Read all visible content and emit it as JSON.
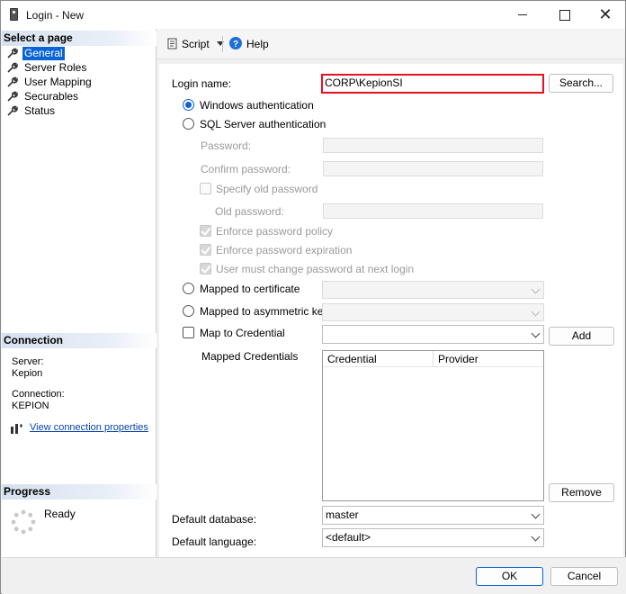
{
  "window": {
    "title": "Login - New"
  },
  "left_panel": {
    "select_page_header": "Select a page",
    "pages": [
      {
        "label": "General",
        "icon": "wrench-icon",
        "selected": true
      },
      {
        "label": "Server Roles",
        "icon": "wrench-icon",
        "selected": false
      },
      {
        "label": "User Mapping",
        "icon": "wrench-icon",
        "selected": false
      },
      {
        "label": "Securables",
        "icon": "wrench-icon",
        "selected": false
      },
      {
        "label": "Status",
        "icon": "wrench-icon",
        "selected": false
      }
    ],
    "connection": {
      "header": "Connection",
      "server_label": "Server:",
      "server_value": "Kepion",
      "connection_label": "Connection:",
      "connection_value": "KEPION",
      "view_properties_link": "View connection properties"
    },
    "progress": {
      "header": "Progress",
      "status": "Ready"
    }
  },
  "toolbar": {
    "script_label": "Script",
    "help_label": "Help"
  },
  "form": {
    "login_name_label": "Login name:",
    "login_name_value": "CORP\\KepionSI",
    "search_button": "Search...",
    "windows_auth_label": "Windows authentication",
    "sql_auth_label": "SQL Server authentication",
    "password_label": "Password:",
    "confirm_password_label": "Confirm password:",
    "specify_old_password_label": "Specify old password",
    "old_password_label": "Old password:",
    "enforce_policy_label": "Enforce password policy",
    "enforce_expiration_label": "Enforce password expiration",
    "must_change_label": "User must change password at next login",
    "mapped_cert_label": "Mapped to certificate",
    "mapped_asym_label": "Mapped to asymmetric key",
    "map_credential_label": "Map to Credential",
    "add_button": "Add",
    "mapped_credentials_label": "Mapped Credentials",
    "credentials_columns": [
      "Credential",
      "Provider"
    ],
    "remove_button": "Remove",
    "default_database_label": "Default database:",
    "default_database_value": "master",
    "default_language_label": "Default language:",
    "default_language_value": "<default>"
  },
  "footer": {
    "ok_button": "OK",
    "cancel_button": "Cancel"
  },
  "colors": {
    "accent": "#0a64d8",
    "highlight_border": "#e81123",
    "link": "#0645ad"
  }
}
